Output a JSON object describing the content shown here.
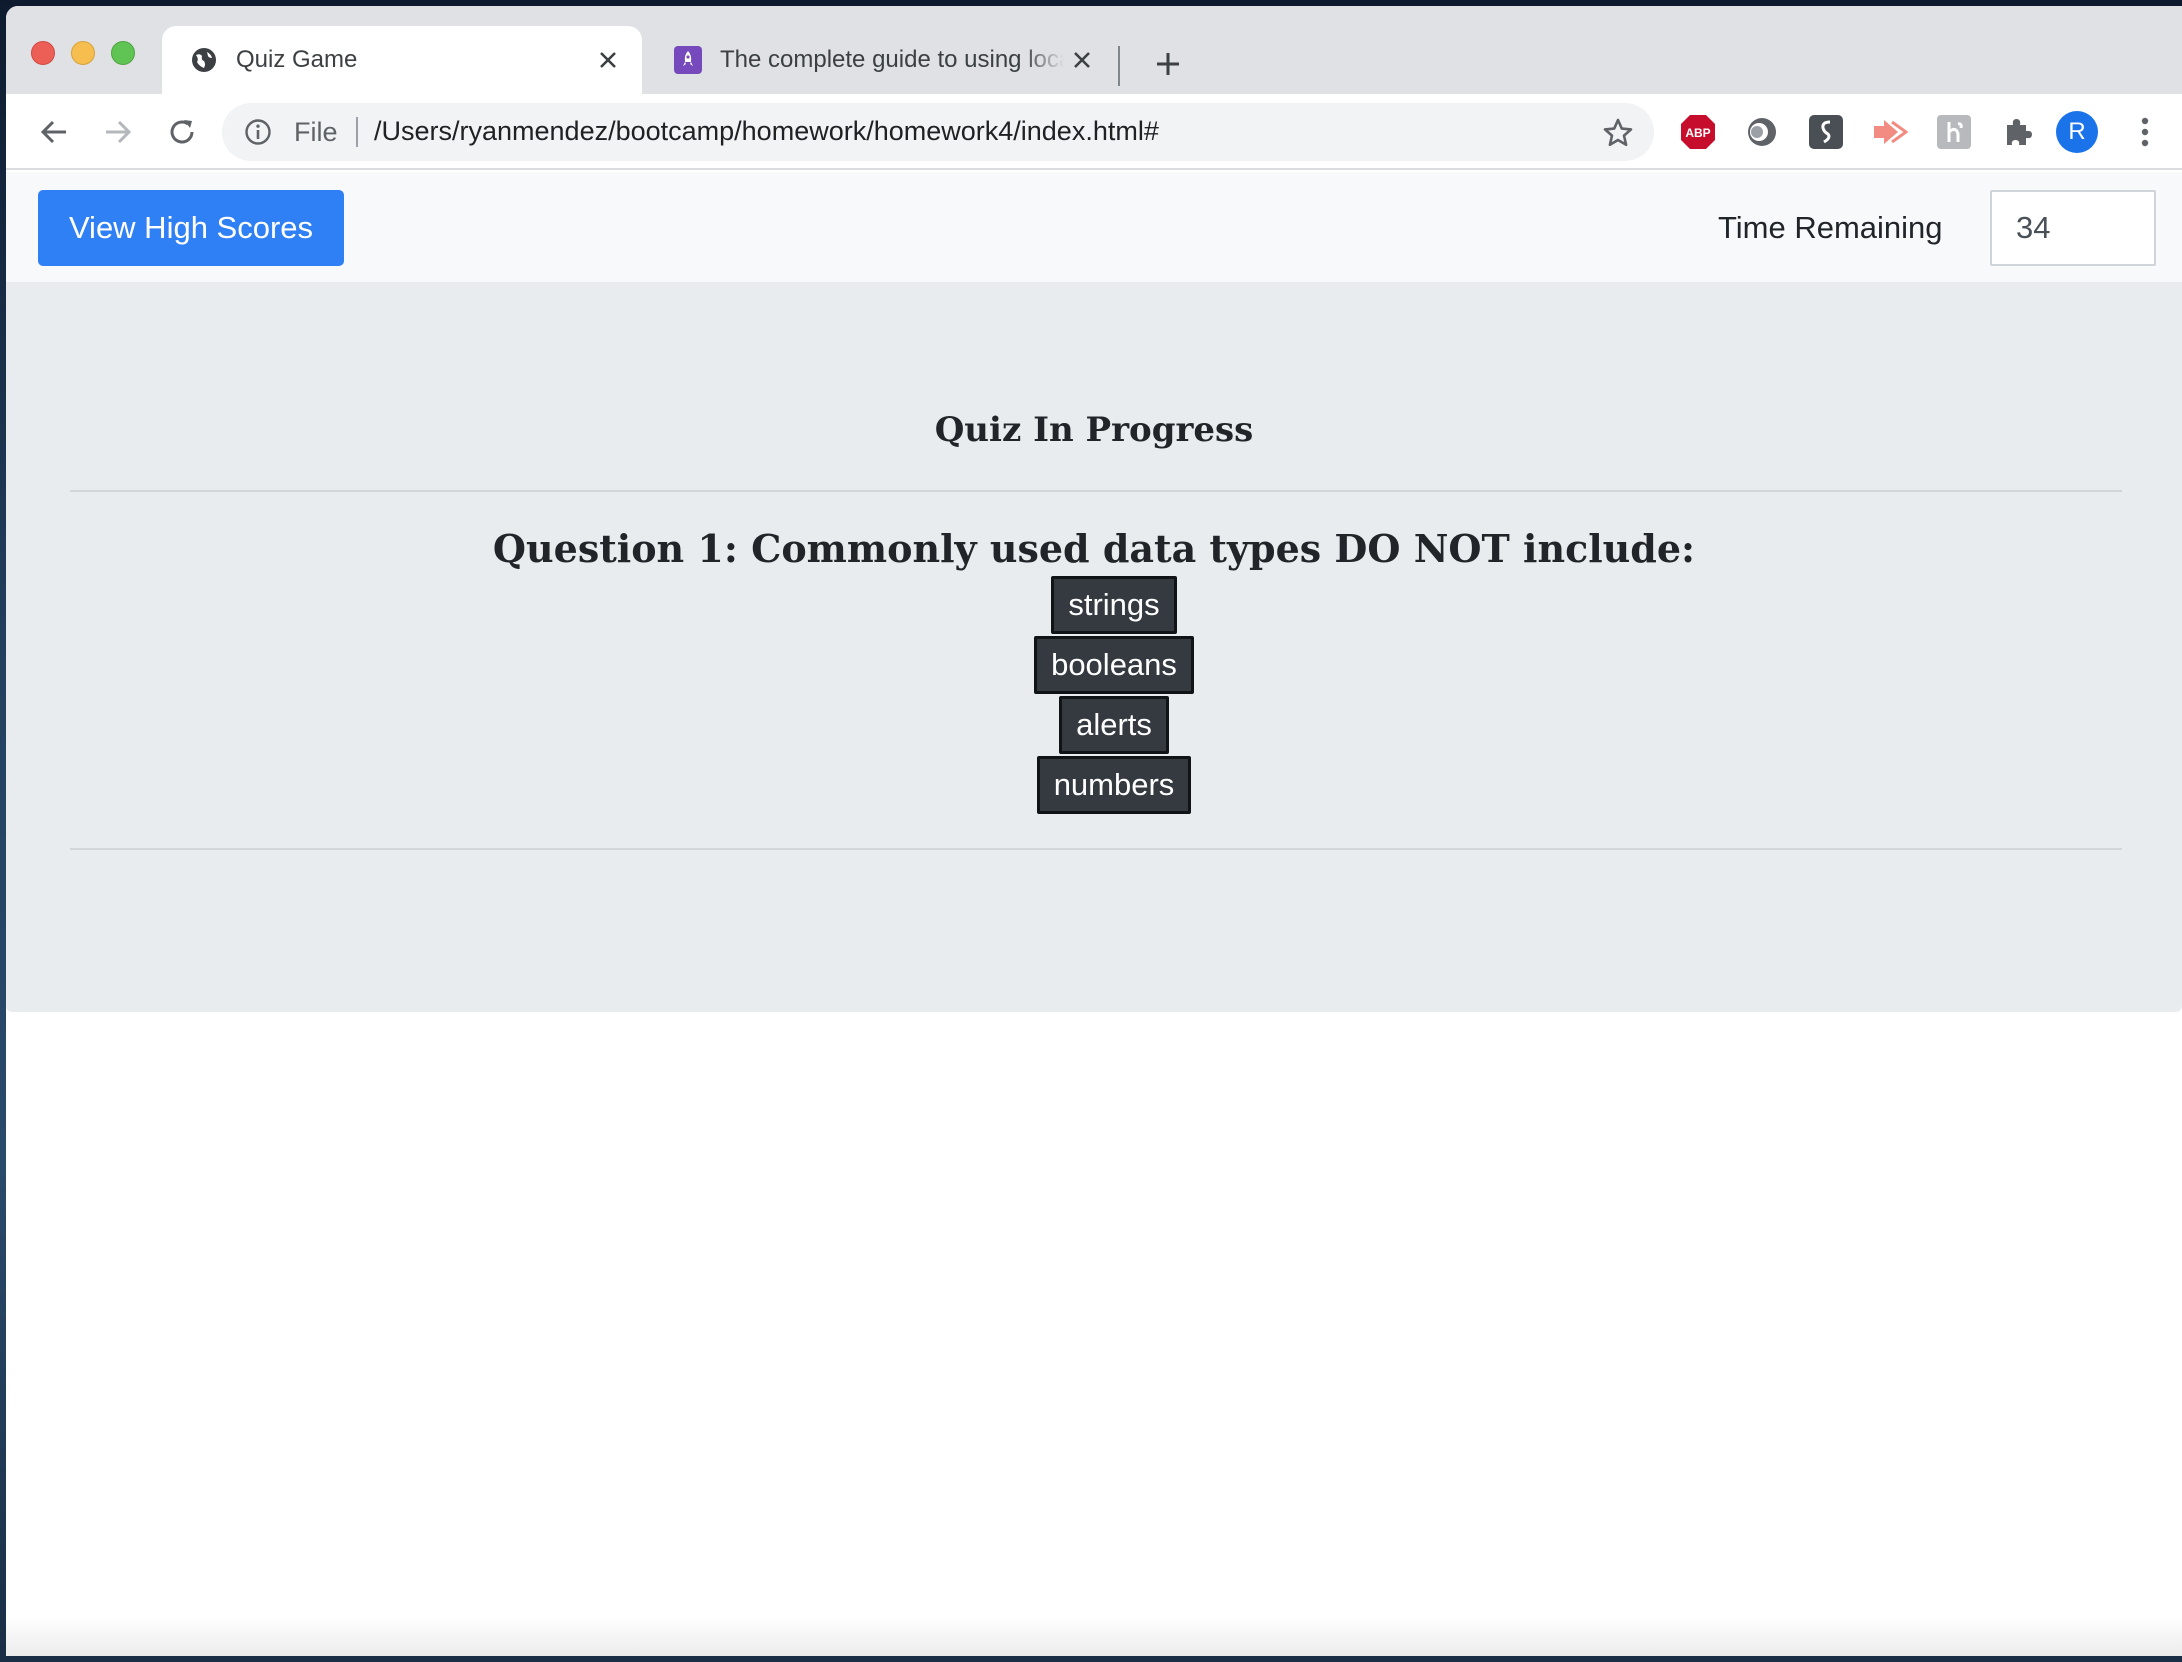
{
  "browser": {
    "tabs": [
      {
        "title": "Quiz Game",
        "favicon": "globe-icon",
        "active": true
      },
      {
        "title": "The complete guide to using localStorage",
        "favicon": "rocket-icon",
        "active": false
      }
    ],
    "omnibox": {
      "scheme_label": "File",
      "url": "/Users/ryanmendez/bootcamp/homework/homework4/index.html#"
    },
    "extensions": [
      "adblock-plus-icon",
      "circle-extension-icon",
      "scribe-extension-icon",
      "arrow-extension-icon",
      "script-extension-icon",
      "puzzle-piece-icon"
    ],
    "extension_labels": {
      "adblock": "ABP"
    },
    "profile_initial": "R"
  },
  "navbar": {
    "high_scores_label": "View High Scores",
    "time_label": "Time Remaining",
    "time_value": "34"
  },
  "quiz": {
    "status": "Quiz In Progress",
    "question": "Question 1: Commonly used data types DO NOT include:",
    "answers": [
      "strings",
      "booleans",
      "alerts",
      "numbers"
    ]
  },
  "colors": {
    "primary_button": "#2f80f4",
    "answer_button": "#343a40",
    "jumbotron": "#e9ecef",
    "navbar": "#f8f9fa"
  }
}
